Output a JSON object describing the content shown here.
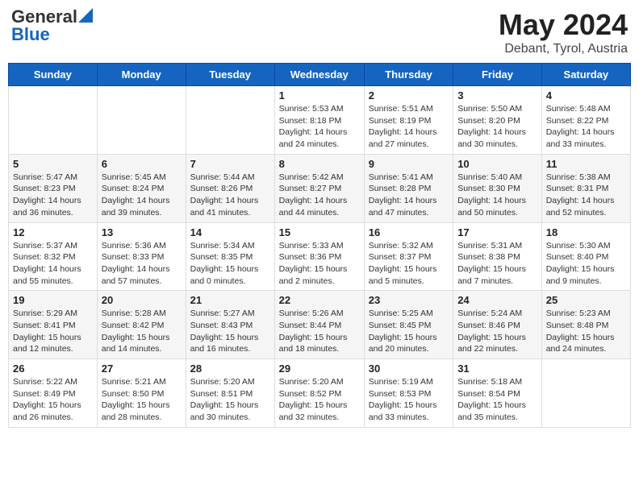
{
  "header": {
    "logo_general": "General",
    "logo_blue": "Blue",
    "month": "May 2024",
    "location": "Debant, Tyrol, Austria"
  },
  "days_of_week": [
    "Sunday",
    "Monday",
    "Tuesday",
    "Wednesday",
    "Thursday",
    "Friday",
    "Saturday"
  ],
  "weeks": [
    [
      {
        "day": "",
        "sunrise": "",
        "sunset": "",
        "daylight": ""
      },
      {
        "day": "",
        "sunrise": "",
        "sunset": "",
        "daylight": ""
      },
      {
        "day": "",
        "sunrise": "",
        "sunset": "",
        "daylight": ""
      },
      {
        "day": "1",
        "sunrise": "Sunrise: 5:53 AM",
        "sunset": "Sunset: 8:18 PM",
        "daylight": "Daylight: 14 hours and 24 minutes."
      },
      {
        "day": "2",
        "sunrise": "Sunrise: 5:51 AM",
        "sunset": "Sunset: 8:19 PM",
        "daylight": "Daylight: 14 hours and 27 minutes."
      },
      {
        "day": "3",
        "sunrise": "Sunrise: 5:50 AM",
        "sunset": "Sunset: 8:20 PM",
        "daylight": "Daylight: 14 hours and 30 minutes."
      },
      {
        "day": "4",
        "sunrise": "Sunrise: 5:48 AM",
        "sunset": "Sunset: 8:22 PM",
        "daylight": "Daylight: 14 hours and 33 minutes."
      }
    ],
    [
      {
        "day": "5",
        "sunrise": "Sunrise: 5:47 AM",
        "sunset": "Sunset: 8:23 PM",
        "daylight": "Daylight: 14 hours and 36 minutes."
      },
      {
        "day": "6",
        "sunrise": "Sunrise: 5:45 AM",
        "sunset": "Sunset: 8:24 PM",
        "daylight": "Daylight: 14 hours and 39 minutes."
      },
      {
        "day": "7",
        "sunrise": "Sunrise: 5:44 AM",
        "sunset": "Sunset: 8:26 PM",
        "daylight": "Daylight: 14 hours and 41 minutes."
      },
      {
        "day": "8",
        "sunrise": "Sunrise: 5:42 AM",
        "sunset": "Sunset: 8:27 PM",
        "daylight": "Daylight: 14 hours and 44 minutes."
      },
      {
        "day": "9",
        "sunrise": "Sunrise: 5:41 AM",
        "sunset": "Sunset: 8:28 PM",
        "daylight": "Daylight: 14 hours and 47 minutes."
      },
      {
        "day": "10",
        "sunrise": "Sunrise: 5:40 AM",
        "sunset": "Sunset: 8:30 PM",
        "daylight": "Daylight: 14 hours and 50 minutes."
      },
      {
        "day": "11",
        "sunrise": "Sunrise: 5:38 AM",
        "sunset": "Sunset: 8:31 PM",
        "daylight": "Daylight: 14 hours and 52 minutes."
      }
    ],
    [
      {
        "day": "12",
        "sunrise": "Sunrise: 5:37 AM",
        "sunset": "Sunset: 8:32 PM",
        "daylight": "Daylight: 14 hours and 55 minutes."
      },
      {
        "day": "13",
        "sunrise": "Sunrise: 5:36 AM",
        "sunset": "Sunset: 8:33 PM",
        "daylight": "Daylight: 14 hours and 57 minutes."
      },
      {
        "day": "14",
        "sunrise": "Sunrise: 5:34 AM",
        "sunset": "Sunset: 8:35 PM",
        "daylight": "Daylight: 15 hours and 0 minutes."
      },
      {
        "day": "15",
        "sunrise": "Sunrise: 5:33 AM",
        "sunset": "Sunset: 8:36 PM",
        "daylight": "Daylight: 15 hours and 2 minutes."
      },
      {
        "day": "16",
        "sunrise": "Sunrise: 5:32 AM",
        "sunset": "Sunset: 8:37 PM",
        "daylight": "Daylight: 15 hours and 5 minutes."
      },
      {
        "day": "17",
        "sunrise": "Sunrise: 5:31 AM",
        "sunset": "Sunset: 8:38 PM",
        "daylight": "Daylight: 15 hours and 7 minutes."
      },
      {
        "day": "18",
        "sunrise": "Sunrise: 5:30 AM",
        "sunset": "Sunset: 8:40 PM",
        "daylight": "Daylight: 15 hours and 9 minutes."
      }
    ],
    [
      {
        "day": "19",
        "sunrise": "Sunrise: 5:29 AM",
        "sunset": "Sunset: 8:41 PM",
        "daylight": "Daylight: 15 hours and 12 minutes."
      },
      {
        "day": "20",
        "sunrise": "Sunrise: 5:28 AM",
        "sunset": "Sunset: 8:42 PM",
        "daylight": "Daylight: 15 hours and 14 minutes."
      },
      {
        "day": "21",
        "sunrise": "Sunrise: 5:27 AM",
        "sunset": "Sunset: 8:43 PM",
        "daylight": "Daylight: 15 hours and 16 minutes."
      },
      {
        "day": "22",
        "sunrise": "Sunrise: 5:26 AM",
        "sunset": "Sunset: 8:44 PM",
        "daylight": "Daylight: 15 hours and 18 minutes."
      },
      {
        "day": "23",
        "sunrise": "Sunrise: 5:25 AM",
        "sunset": "Sunset: 8:45 PM",
        "daylight": "Daylight: 15 hours and 20 minutes."
      },
      {
        "day": "24",
        "sunrise": "Sunrise: 5:24 AM",
        "sunset": "Sunset: 8:46 PM",
        "daylight": "Daylight: 15 hours and 22 minutes."
      },
      {
        "day": "25",
        "sunrise": "Sunrise: 5:23 AM",
        "sunset": "Sunset: 8:48 PM",
        "daylight": "Daylight: 15 hours and 24 minutes."
      }
    ],
    [
      {
        "day": "26",
        "sunrise": "Sunrise: 5:22 AM",
        "sunset": "Sunset: 8:49 PM",
        "daylight": "Daylight: 15 hours and 26 minutes."
      },
      {
        "day": "27",
        "sunrise": "Sunrise: 5:21 AM",
        "sunset": "Sunset: 8:50 PM",
        "daylight": "Daylight: 15 hours and 28 minutes."
      },
      {
        "day": "28",
        "sunrise": "Sunrise: 5:20 AM",
        "sunset": "Sunset: 8:51 PM",
        "daylight": "Daylight: 15 hours and 30 minutes."
      },
      {
        "day": "29",
        "sunrise": "Sunrise: 5:20 AM",
        "sunset": "Sunset: 8:52 PM",
        "daylight": "Daylight: 15 hours and 32 minutes."
      },
      {
        "day": "30",
        "sunrise": "Sunrise: 5:19 AM",
        "sunset": "Sunset: 8:53 PM",
        "daylight": "Daylight: 15 hours and 33 minutes."
      },
      {
        "day": "31",
        "sunrise": "Sunrise: 5:18 AM",
        "sunset": "Sunset: 8:54 PM",
        "daylight": "Daylight: 15 hours and 35 minutes."
      },
      {
        "day": "",
        "sunrise": "",
        "sunset": "",
        "daylight": ""
      }
    ]
  ]
}
